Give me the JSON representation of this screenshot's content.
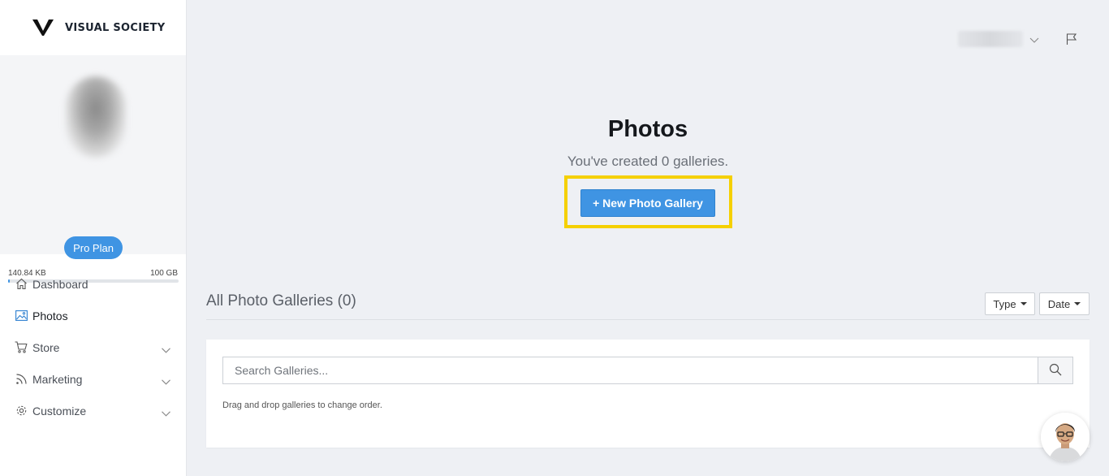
{
  "brand": {
    "name": "VISUAL SOCIETY"
  },
  "profile": {
    "plan_label": "Pro Plan",
    "storage_used": "140.84 KB",
    "storage_total": "100 GB",
    "storage_fraction": 0.01
  },
  "nav": {
    "items": [
      {
        "label": "Dashboard",
        "icon": "home-icon",
        "active": false,
        "expandable": false
      },
      {
        "label": "Photos",
        "icon": "image-icon",
        "active": true,
        "expandable": false
      },
      {
        "label": "Store",
        "icon": "cart-icon",
        "active": false,
        "expandable": true
      },
      {
        "label": "Marketing",
        "icon": "rss-icon",
        "active": false,
        "expandable": true
      },
      {
        "label": "Customize",
        "icon": "gear-icon",
        "active": false,
        "expandable": true
      }
    ]
  },
  "header": {
    "icons": [
      "chevron-down-icon",
      "flag-icon"
    ]
  },
  "hero": {
    "title": "Photos",
    "subtitle": "You've created 0 galleries.",
    "new_gallery_label": "+ New Photo Gallery"
  },
  "galleries": {
    "title": "All Photo Galleries (0)",
    "type_label": "Type",
    "date_label": "Date",
    "search_placeholder": "Search Galleries...",
    "hint": "Drag and drop galleries to change order."
  },
  "colors": {
    "accent": "#3f94e3",
    "highlight": "#f5d000",
    "background": "#eef0f4"
  }
}
